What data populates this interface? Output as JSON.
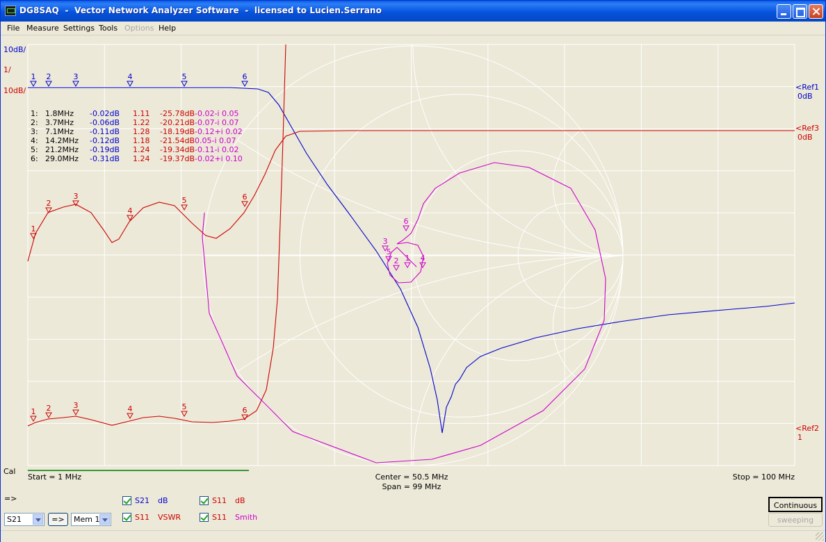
{
  "app": {
    "title": "DG8SAQ  -  Vector Network Analyzer Software  -  licensed to Lucien.Serrano"
  },
  "menu": [
    {
      "label": "File",
      "enabled": true
    },
    {
      "label": "Measure",
      "enabled": true
    },
    {
      "label": "Settings",
      "enabled": true
    },
    {
      "label": "Tools",
      "enabled": true
    },
    {
      "label": "Options",
      "enabled": false
    },
    {
      "label": "Help",
      "enabled": true
    }
  ],
  "scales": {
    "s21_db": "10dB/",
    "vswr": "1/",
    "s11_db": "10dB/"
  },
  "refs": [
    {
      "label": "<Ref1",
      "value": "0dB",
      "color": "#0000cc"
    },
    {
      "label": "<Ref3",
      "value": "0dB",
      "color": "#cc0000"
    },
    {
      "label": "<Ref2",
      "value": "1",
      "color": "#cc0000"
    }
  ],
  "markers": [
    {
      "id": "1:",
      "freq": "1.8MHz",
      "s21": "-0.02dB",
      "vswr": "1.11",
      "s11": "-25.78dB",
      "z": "-0.02-i 0.05"
    },
    {
      "id": "2:",
      "freq": "3.7MHz",
      "s21": "-0.06dB",
      "vswr": "1.22",
      "s11": "-20.21dB",
      "z": "-0.07-i 0.07"
    },
    {
      "id": "3:",
      "freq": "7.1MHz",
      "s21": "-0.11dB",
      "vswr": "1.28",
      "s11": "-18.19dB",
      "z": "-0.12+i 0.02"
    },
    {
      "id": "4:",
      "freq": "14.2MHz",
      "s21": "-0.12dB",
      "vswr": "1.18",
      "s11": "-21.54dB",
      "z": "0.05-i 0.07"
    },
    {
      "id": "5:",
      "freq": "21.2MHz",
      "s21": "-0.19dB",
      "vswr": "1.24",
      "s11": "-19.34dB",
      "z": "-0.11-i 0.02"
    },
    {
      "id": "6:",
      "freq": "29.0MHz",
      "s21": "-0.31dB",
      "vswr": "1.24",
      "s11": "-19.37dB",
      "z": "-0.02+i 0.10"
    }
  ],
  "marker_numbers": [
    "1",
    "2",
    "3",
    "4",
    "5",
    "6"
  ],
  "sweep": {
    "start": "Start = 1 MHz",
    "center": "Center = 50.5 MHz",
    "span": "Span = 99 MHz",
    "stop": "Stop = 100 MHz",
    "cal": "Cal"
  },
  "traces": [
    {
      "param": "S21",
      "format": "dB",
      "param_color": "#0000cc",
      "format_color": "#0000cc",
      "checked": true
    },
    {
      "param": "S11",
      "format": "dB",
      "param_color": "#cc0000",
      "format_color": "#cc0000",
      "checked": true
    },
    {
      "param": "S11",
      "format": "VSWR",
      "param_color": "#cc0000",
      "format_color": "#cc0000",
      "checked": true
    },
    {
      "param": "S11",
      "format": "Smith",
      "param_color": "#cc0000",
      "format_color": "#cc00cc",
      "checked": true
    }
  ],
  "controls": {
    "arrow_label": "=>",
    "param_select": "S21",
    "copy_button": "=>",
    "mem_select": "Mem 1",
    "continuous_button": "Continuous",
    "sweeping_button": "sweeping"
  },
  "colors": {
    "plot_bg": "#ece9d8",
    "grid": "#ffffff",
    "s21": "#0000cc",
    "s11": "#cc0000",
    "smith": "#cc00cc"
  }
}
